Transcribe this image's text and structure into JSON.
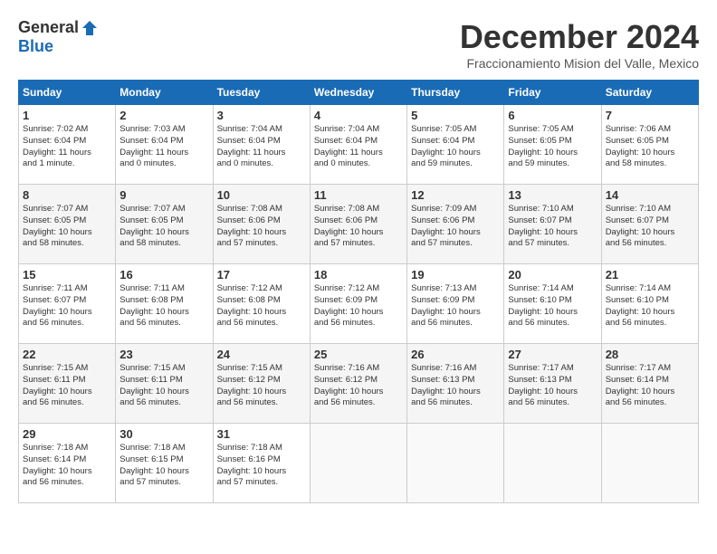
{
  "logo": {
    "general": "General",
    "blue": "Blue"
  },
  "title": {
    "month": "December 2024",
    "location": "Fraccionamiento Mision del Valle, Mexico"
  },
  "weekdays": [
    "Sunday",
    "Monday",
    "Tuesday",
    "Wednesday",
    "Thursday",
    "Friday",
    "Saturday"
  ],
  "weeks": [
    [
      {
        "day": "1",
        "info": "Sunrise: 7:02 AM\nSunset: 6:04 PM\nDaylight: 11 hours\nand 1 minute."
      },
      {
        "day": "2",
        "info": "Sunrise: 7:03 AM\nSunset: 6:04 PM\nDaylight: 11 hours\nand 0 minutes."
      },
      {
        "day": "3",
        "info": "Sunrise: 7:04 AM\nSunset: 6:04 PM\nDaylight: 11 hours\nand 0 minutes."
      },
      {
        "day": "4",
        "info": "Sunrise: 7:04 AM\nSunset: 6:04 PM\nDaylight: 11 hours\nand 0 minutes."
      },
      {
        "day": "5",
        "info": "Sunrise: 7:05 AM\nSunset: 6:04 PM\nDaylight: 10 hours\nand 59 minutes."
      },
      {
        "day": "6",
        "info": "Sunrise: 7:05 AM\nSunset: 6:05 PM\nDaylight: 10 hours\nand 59 minutes."
      },
      {
        "day": "7",
        "info": "Sunrise: 7:06 AM\nSunset: 6:05 PM\nDaylight: 10 hours\nand 58 minutes."
      }
    ],
    [
      {
        "day": "8",
        "info": "Sunrise: 7:07 AM\nSunset: 6:05 PM\nDaylight: 10 hours\nand 58 minutes."
      },
      {
        "day": "9",
        "info": "Sunrise: 7:07 AM\nSunset: 6:05 PM\nDaylight: 10 hours\nand 58 minutes."
      },
      {
        "day": "10",
        "info": "Sunrise: 7:08 AM\nSunset: 6:06 PM\nDaylight: 10 hours\nand 57 minutes."
      },
      {
        "day": "11",
        "info": "Sunrise: 7:08 AM\nSunset: 6:06 PM\nDaylight: 10 hours\nand 57 minutes."
      },
      {
        "day": "12",
        "info": "Sunrise: 7:09 AM\nSunset: 6:06 PM\nDaylight: 10 hours\nand 57 minutes."
      },
      {
        "day": "13",
        "info": "Sunrise: 7:10 AM\nSunset: 6:07 PM\nDaylight: 10 hours\nand 57 minutes."
      },
      {
        "day": "14",
        "info": "Sunrise: 7:10 AM\nSunset: 6:07 PM\nDaylight: 10 hours\nand 56 minutes."
      }
    ],
    [
      {
        "day": "15",
        "info": "Sunrise: 7:11 AM\nSunset: 6:07 PM\nDaylight: 10 hours\nand 56 minutes."
      },
      {
        "day": "16",
        "info": "Sunrise: 7:11 AM\nSunset: 6:08 PM\nDaylight: 10 hours\nand 56 minutes."
      },
      {
        "day": "17",
        "info": "Sunrise: 7:12 AM\nSunset: 6:08 PM\nDaylight: 10 hours\nand 56 minutes."
      },
      {
        "day": "18",
        "info": "Sunrise: 7:12 AM\nSunset: 6:09 PM\nDaylight: 10 hours\nand 56 minutes."
      },
      {
        "day": "19",
        "info": "Sunrise: 7:13 AM\nSunset: 6:09 PM\nDaylight: 10 hours\nand 56 minutes."
      },
      {
        "day": "20",
        "info": "Sunrise: 7:14 AM\nSunset: 6:10 PM\nDaylight: 10 hours\nand 56 minutes."
      },
      {
        "day": "21",
        "info": "Sunrise: 7:14 AM\nSunset: 6:10 PM\nDaylight: 10 hours\nand 56 minutes."
      }
    ],
    [
      {
        "day": "22",
        "info": "Sunrise: 7:15 AM\nSunset: 6:11 PM\nDaylight: 10 hours\nand 56 minutes."
      },
      {
        "day": "23",
        "info": "Sunrise: 7:15 AM\nSunset: 6:11 PM\nDaylight: 10 hours\nand 56 minutes."
      },
      {
        "day": "24",
        "info": "Sunrise: 7:15 AM\nSunset: 6:12 PM\nDaylight: 10 hours\nand 56 minutes."
      },
      {
        "day": "25",
        "info": "Sunrise: 7:16 AM\nSunset: 6:12 PM\nDaylight: 10 hours\nand 56 minutes."
      },
      {
        "day": "26",
        "info": "Sunrise: 7:16 AM\nSunset: 6:13 PM\nDaylight: 10 hours\nand 56 minutes."
      },
      {
        "day": "27",
        "info": "Sunrise: 7:17 AM\nSunset: 6:13 PM\nDaylight: 10 hours\nand 56 minutes."
      },
      {
        "day": "28",
        "info": "Sunrise: 7:17 AM\nSunset: 6:14 PM\nDaylight: 10 hours\nand 56 minutes."
      }
    ],
    [
      {
        "day": "29",
        "info": "Sunrise: 7:18 AM\nSunset: 6:14 PM\nDaylight: 10 hours\nand 56 minutes."
      },
      {
        "day": "30",
        "info": "Sunrise: 7:18 AM\nSunset: 6:15 PM\nDaylight: 10 hours\nand 57 minutes."
      },
      {
        "day": "31",
        "info": "Sunrise: 7:18 AM\nSunset: 6:16 PM\nDaylight: 10 hours\nand 57 minutes."
      },
      {
        "day": "",
        "info": ""
      },
      {
        "day": "",
        "info": ""
      },
      {
        "day": "",
        "info": ""
      },
      {
        "day": "",
        "info": ""
      }
    ]
  ]
}
